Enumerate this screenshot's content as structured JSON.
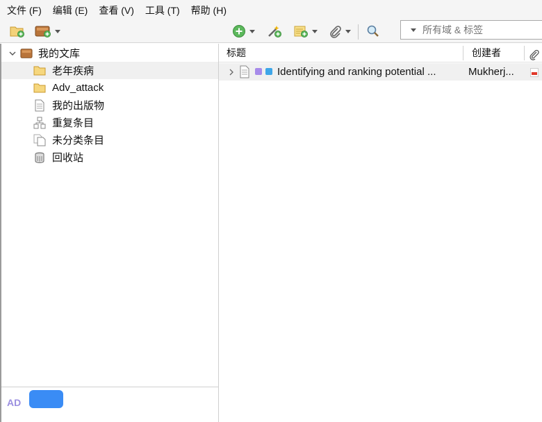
{
  "menubar": {
    "items": [
      {
        "label": "文件 (F)"
      },
      {
        "label": "编辑 (E)"
      },
      {
        "label": "查看 (V)"
      },
      {
        "label": "工具 (T)"
      },
      {
        "label": "帮助 (H)"
      }
    ]
  },
  "toolbar": {
    "search_placeholder": "所有域 & 标签"
  },
  "sidebar": {
    "library_label": "我的文库",
    "items": [
      {
        "label": "老年疾病",
        "icon": "folder-icon",
        "selected": true
      },
      {
        "label": "Adv_attack",
        "icon": "folder-icon",
        "selected": false
      },
      {
        "label": "我的出版物",
        "icon": "document-icon",
        "selected": false
      },
      {
        "label": "重复条目",
        "icon": "duplicate-icon",
        "selected": false
      },
      {
        "label": "未分类条目",
        "icon": "unfiled-icon",
        "selected": false
      },
      {
        "label": "回收站",
        "icon": "trash-icon",
        "selected": false
      }
    ],
    "tag_selector": {
      "tag_label": "AD",
      "tag_color": "#9b8fe0",
      "pill_color": "#3a8cf5"
    }
  },
  "items_table": {
    "columns": [
      {
        "label": "标题"
      },
      {
        "label": "创建者"
      }
    ],
    "rows": [
      {
        "title": "Identifying and ranking potential ...",
        "creator": "Mukherj...",
        "tag_colors": [
          "#a78bea",
          "#3ea6e8"
        ],
        "has_pdf": true
      }
    ]
  }
}
